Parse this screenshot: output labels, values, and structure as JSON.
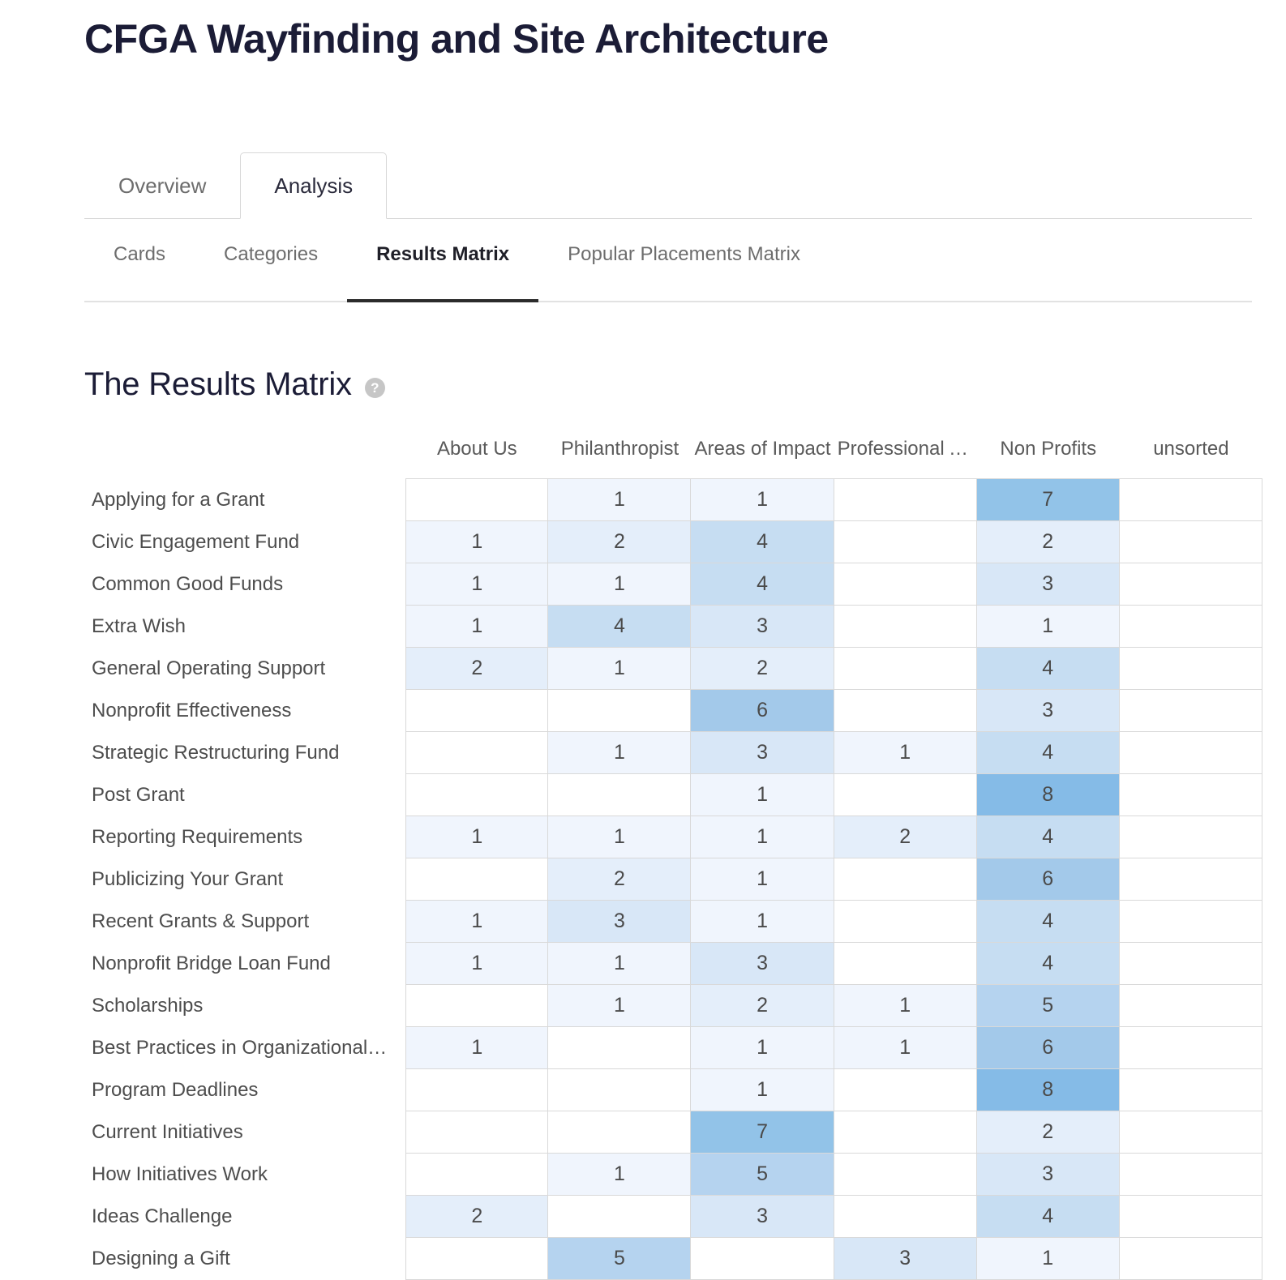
{
  "page_title": "CFGA Wayfinding and Site Architecture",
  "primary_tabs": [
    {
      "label": "Overview",
      "active": false
    },
    {
      "label": "Analysis",
      "active": true
    }
  ],
  "secondary_tabs": [
    {
      "label": "Cards",
      "active": false
    },
    {
      "label": "Categories",
      "active": false
    },
    {
      "label": "Results Matrix",
      "active": true
    },
    {
      "label": "Popular Placements Matrix",
      "active": false
    }
  ],
  "section": {
    "heading": "The Results Matrix",
    "help_icon": "help-circle-icon",
    "help_glyph": "?"
  },
  "colors": {
    "title": "#1b1c36",
    "active_tab_text": "#1f1f28",
    "inactive_tab_text": "#6d6d6d",
    "active_underline": "#2b2b2b",
    "cell_border": "#d9d9d9",
    "heat_1": "#f0f5fd",
    "heat_2": "#e4eefa",
    "heat_3": "#d8e7f7",
    "heat_4": "#c6ddf2",
    "heat_5": "#b5d3ef",
    "heat_6": "#a3c9ea",
    "heat_7": "#92c3e8",
    "heat_8": "#85bbe7"
  },
  "chart_data": {
    "type": "heatmap",
    "title": "The Results Matrix",
    "xlabel": "",
    "ylabel": "",
    "legend_position": "none",
    "grid": true,
    "columns": [
      "About Us",
      "Philanthropist",
      "Areas of Impact",
      "Professional Advi...",
      "Non Profits",
      "unsorted"
    ],
    "rows": [
      "Applying for a Grant",
      "Civic Engagement Fund",
      "Common Good Funds",
      "Extra Wish",
      "General Operating Support",
      "Nonprofit Effectiveness",
      "Strategic Restructuring Fund",
      "Post Grant",
      "Reporting Requirements",
      "Publicizing Your Grant",
      "Recent Grants & Support",
      "Nonprofit Bridge Loan Fund",
      "Scholarships",
      "Best Practices in Organizational M...",
      "Program Deadlines",
      "Current Initiatives",
      "How Initiatives Work",
      "Ideas Challenge",
      "Designing a Gift"
    ],
    "values": [
      [
        null,
        1,
        1,
        null,
        7,
        null
      ],
      [
        1,
        2,
        4,
        null,
        2,
        null
      ],
      [
        1,
        1,
        4,
        null,
        3,
        null
      ],
      [
        1,
        4,
        3,
        null,
        1,
        null
      ],
      [
        2,
        1,
        2,
        null,
        4,
        null
      ],
      [
        null,
        null,
        6,
        null,
        3,
        null
      ],
      [
        null,
        1,
        3,
        1,
        4,
        null
      ],
      [
        null,
        null,
        1,
        null,
        8,
        null
      ],
      [
        1,
        1,
        1,
        2,
        4,
        null
      ],
      [
        null,
        2,
        1,
        null,
        6,
        null
      ],
      [
        1,
        3,
        1,
        null,
        4,
        null
      ],
      [
        1,
        1,
        3,
        null,
        4,
        null
      ],
      [
        null,
        1,
        2,
        1,
        5,
        null
      ],
      [
        1,
        null,
        1,
        1,
        6,
        null
      ],
      [
        null,
        null,
        1,
        null,
        8,
        null
      ],
      [
        null,
        null,
        7,
        null,
        2,
        null
      ],
      [
        null,
        1,
        5,
        null,
        3,
        null
      ],
      [
        2,
        null,
        3,
        null,
        4,
        null
      ],
      [
        null,
        5,
        null,
        3,
        1,
        null
      ]
    ],
    "value_range": [
      1,
      8
    ]
  }
}
